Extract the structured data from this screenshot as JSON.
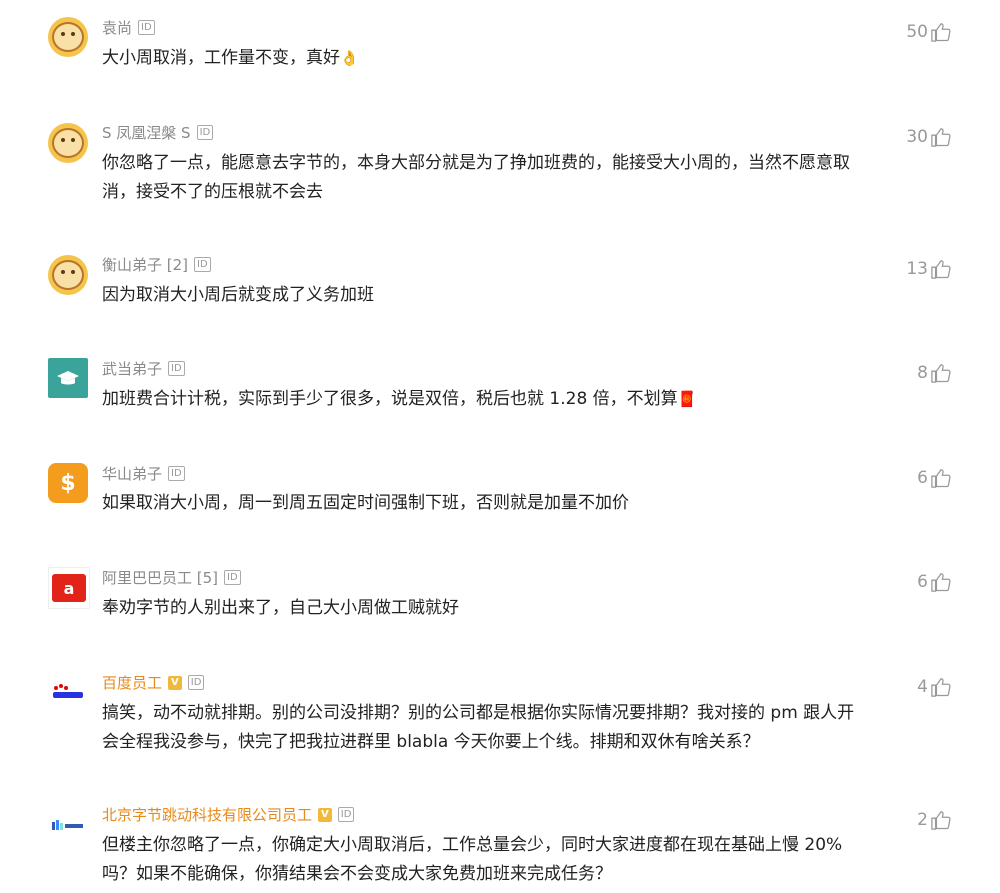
{
  "comments": [
    {
      "name": "袁尚",
      "id_badge": "ID",
      "text": "大小周取消，工作量不变，真好",
      "emoji": "👌",
      "likes": "50",
      "avatar": "monkey-icon"
    },
    {
      "name": "S 凤凰涅槃 S",
      "id_badge": "ID",
      "text": "你忽略了一点，能愿意去字节的，本身大部分就是为了挣加班费的，能接受大小周的，当然不愿意取消，接受不了的压根就不会去",
      "likes": "30",
      "avatar": "monkey-icon"
    },
    {
      "name": "衡山弟子 [2]",
      "id_badge": "ID",
      "text": "因为取消大小周后就变成了义务加班",
      "likes": "13",
      "avatar": "monkey-icon"
    },
    {
      "name": "武当弟子",
      "id_badge": "ID",
      "text": "加班费合计计税，实际到手少了很多，说是双倍，税后也就 1.28 倍，不划算",
      "emoji": "🧧",
      "likes": "8",
      "avatar": "graduation-cap-icon"
    },
    {
      "name": "华山弟子",
      "id_badge": "ID",
      "text": "如果取消大小周，周一到周五固定时间强制下班，否则就是加量不加价",
      "likes": "6",
      "avatar": "dollar-coin-icon"
    },
    {
      "name": "阿里巴巴员工 [5]",
      "id_badge": "ID",
      "text": "奉劝字节的人别出来了，自己大小周做工贼就好",
      "likes": "6",
      "avatar": "alibaba-logo-icon"
    },
    {
      "name": "百度员工",
      "v_badge": "V",
      "id_badge": "ID",
      "text": "搞笑，动不动就排期。别的公司没排期？别的公司都是根据你实际情况要排期？我对接的 pm 跟人开会全程我没参与，快完了把我拉进群里 blabla 今天你要上个线。排期和双休有啥关系？",
      "likes": "4",
      "avatar": "baidu-logo-icon"
    },
    {
      "name": "北京字节跳动科技有限公司员工",
      "v_badge": "V",
      "id_badge": "ID",
      "text": "但楼主你忽略了一点，你确定大小周取消后，工作总量会少，同时大家进度都在现在基础上慢 20% 吗？如果不能确保，你猜结果会不会变成大家免费加班来完成任务？",
      "likes": "2",
      "avatar": "bytedance-logo-icon"
    }
  ],
  "colors": {
    "org_name": "#e88a1a",
    "name": "#8a8a8a",
    "text": "#222222",
    "likes": "#999999"
  }
}
